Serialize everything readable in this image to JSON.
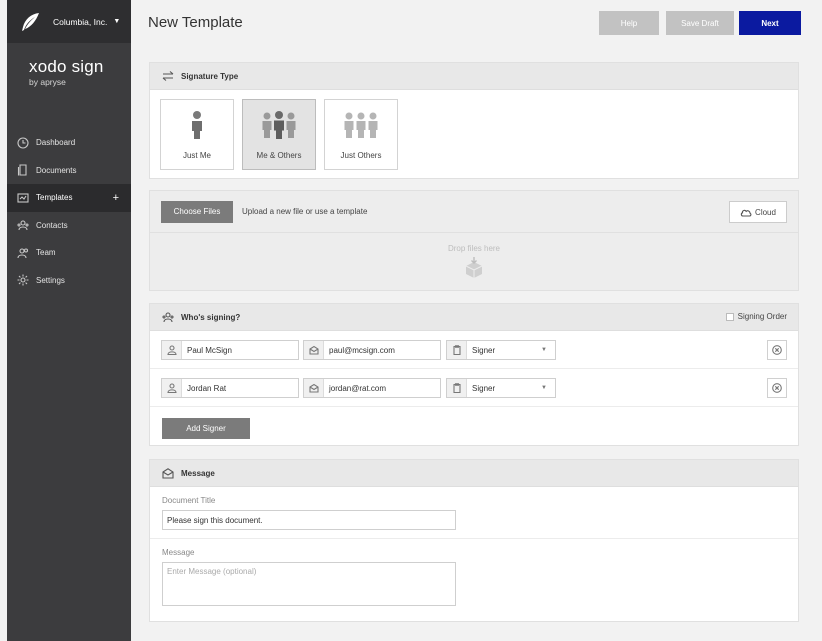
{
  "sidebar": {
    "org_name": "Columbia, Inc.",
    "brand_name": "xodo sign",
    "brand_sub": "by apryse",
    "items": [
      {
        "label": "Dashboard",
        "icon": "clock-icon"
      },
      {
        "label": "Documents",
        "icon": "documents-icon"
      },
      {
        "label": "Templates",
        "icon": "templates-icon",
        "active": true
      },
      {
        "label": "Contacts",
        "icon": "contacts-icon"
      },
      {
        "label": "Team",
        "icon": "team-icon"
      },
      {
        "label": "Settings",
        "icon": "gear-icon"
      }
    ],
    "add_symbol": "+"
  },
  "header": {
    "title": "New Template",
    "help_label": "Help",
    "save_draft_label": "Save Draft",
    "next_label": "Next"
  },
  "signature_type": {
    "heading": "Signature Type",
    "options": [
      {
        "label": "Just Me"
      },
      {
        "label": "Me & Others",
        "selected": true
      },
      {
        "label": "Just Others"
      }
    ]
  },
  "files": {
    "choose_label": "Choose Files",
    "upload_text": "Upload a new file or use a template",
    "cloud_label": "Cloud",
    "drop_text": "Drop files here"
  },
  "signers": {
    "heading": "Who's signing?",
    "signing_order_label": "Signing Order",
    "rows": [
      {
        "name": "Paul McSign",
        "email": "paul@mcsign.com",
        "role": "Signer"
      },
      {
        "name": "Jordan Rat",
        "email": "jordan@rat.com",
        "role": "Signer"
      }
    ],
    "add_label": "Add Signer"
  },
  "message": {
    "heading": "Message",
    "doc_title_label": "Document Title",
    "doc_title_value": "Please sign this document.",
    "message_label": "Message",
    "message_placeholder": "Enter Message (optional)"
  },
  "colors": {
    "sidebar_bg": "#3c3c3e",
    "accent": "#0b1aa0",
    "button_gray": "#7b7b7b"
  }
}
